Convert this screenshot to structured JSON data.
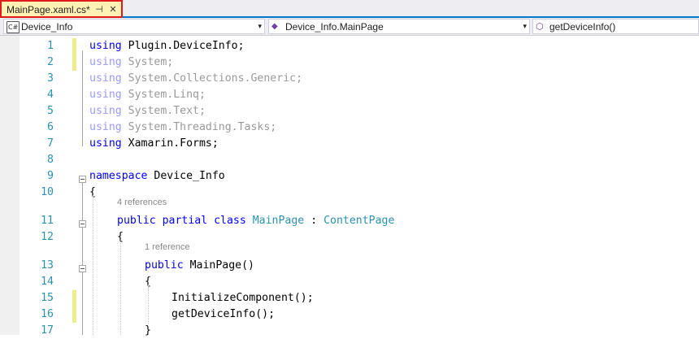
{
  "tab": {
    "title": "MainPage.xaml.cs*",
    "pin_glyph": "⊣",
    "close_glyph": "✕",
    "highlight_color": "#e31a1c"
  },
  "nav": {
    "project": {
      "icon": "C#",
      "label": "Device_Info",
      "arrow": "▾"
    },
    "type": {
      "icon": "◆",
      "label": "Device_Info.MainPage",
      "arrow": "▾"
    },
    "member": {
      "icon": "⬡",
      "label": "getDeviceInfo()"
    }
  },
  "lines": [
    {
      "num": "1",
      "changed": true,
      "tokens": [
        {
          "t": "using ",
          "c": "kw"
        },
        {
          "t": "Plugin.DeviceInfo;",
          "c": ""
        }
      ]
    },
    {
      "num": "2",
      "changed": true,
      "tokens": [
        {
          "t": "using ",
          "c": "dim-kw"
        },
        {
          "t": "System;",
          "c": "dim"
        }
      ]
    },
    {
      "num": "3",
      "changed": false,
      "tokens": [
        {
          "t": "using ",
          "c": "dim-kw"
        },
        {
          "t": "System.Collections.Generic;",
          "c": "dim"
        }
      ]
    },
    {
      "num": "4",
      "changed": false,
      "tokens": [
        {
          "t": "using ",
          "c": "dim-kw"
        },
        {
          "t": "System.Linq;",
          "c": "dim"
        }
      ]
    },
    {
      "num": "5",
      "changed": false,
      "tokens": [
        {
          "t": "using ",
          "c": "dim-kw"
        },
        {
          "t": "System.Text;",
          "c": "dim"
        }
      ]
    },
    {
      "num": "6",
      "changed": false,
      "tokens": [
        {
          "t": "using ",
          "c": "dim-kw"
        },
        {
          "t": "System.Threading.Tasks;",
          "c": "dim"
        }
      ]
    },
    {
      "num": "7",
      "changed": false,
      "tokens": [
        {
          "t": "using ",
          "c": "kw"
        },
        {
          "t": "Xamarin.Forms;",
          "c": ""
        }
      ]
    },
    {
      "num": "8",
      "changed": false,
      "tokens": []
    },
    {
      "num": "9",
      "changed": false,
      "tokens": [
        {
          "t": "namespace ",
          "c": "kw"
        },
        {
          "t": "Device_Info",
          "c": ""
        }
      ]
    },
    {
      "num": "10",
      "changed": false,
      "tokens": [
        {
          "t": "{",
          "c": ""
        }
      ]
    },
    {
      "num": "11",
      "changed": false,
      "lens": "4 references",
      "tokens": [
        {
          "t": "public partial class ",
          "c": "kw"
        },
        {
          "t": "MainPage",
          "c": "type"
        },
        {
          "t": " : ",
          "c": ""
        },
        {
          "t": "ContentPage",
          "c": "type"
        }
      ]
    },
    {
      "num": "12",
      "changed": false,
      "tokens": [
        {
          "t": "{",
          "c": ""
        }
      ]
    },
    {
      "num": "13",
      "changed": false,
      "lens": "1 reference",
      "tokens": [
        {
          "t": "public ",
          "c": "kw"
        },
        {
          "t": "MainPage()",
          "c": ""
        }
      ]
    },
    {
      "num": "14",
      "changed": false,
      "tokens": [
        {
          "t": "{",
          "c": ""
        }
      ]
    },
    {
      "num": "15",
      "changed": true,
      "tokens": [
        {
          "t": "InitializeComponent();",
          "c": ""
        }
      ]
    },
    {
      "num": "16",
      "changed": true,
      "tokens": [
        {
          "t": "getDeviceInfo();",
          "c": ""
        }
      ]
    },
    {
      "num": "17",
      "changed": false,
      "tokens": [
        {
          "t": "}",
          "c": ""
        }
      ]
    }
  ]
}
